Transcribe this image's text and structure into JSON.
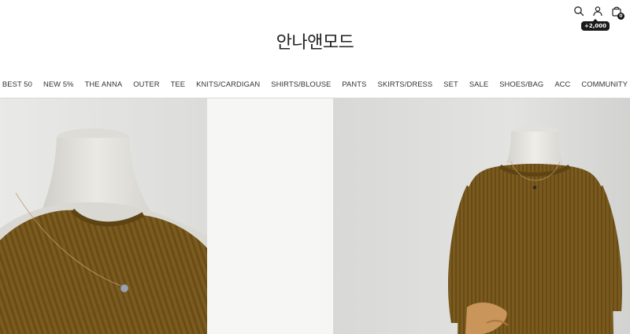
{
  "header": {
    "logo": "안나앤모드",
    "cart_count": "0",
    "points_badge": "+2,000",
    "icons": [
      "search-icon",
      "user-icon",
      "shopping-bag-icon"
    ]
  },
  "nav": {
    "items": [
      {
        "label": "BEST 50"
      },
      {
        "label": "NEW 5%"
      },
      {
        "label": "THE ANNA"
      },
      {
        "label": "OUTER"
      },
      {
        "label": "TEE"
      },
      {
        "label": "KNITS/CARDIGAN"
      },
      {
        "label": "SHIRTS/BLOUSE"
      },
      {
        "label": "PANTS"
      },
      {
        "label": "SKIRTS/DRESS"
      },
      {
        "label": "SET"
      },
      {
        "label": "SALE"
      },
      {
        "label": "SHOES/BAG"
      },
      {
        "label": "ACC"
      },
      {
        "label": "COMMUNITY"
      }
    ]
  },
  "colors": {
    "knit": "#7a5a1e",
    "mannequin": "#e4e2dc",
    "background": "#ffffff"
  }
}
